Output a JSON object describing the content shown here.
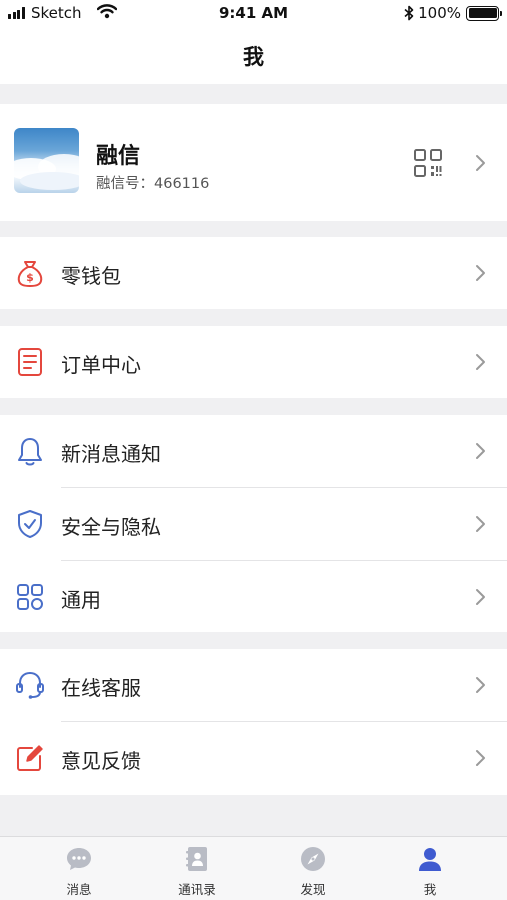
{
  "status_bar": {
    "carrier": "Sketch",
    "time": "9:41 AM",
    "battery_percent": "100%",
    "battery_level": 1.0
  },
  "nav": {
    "title": "我"
  },
  "profile": {
    "name": "融信",
    "id_label": "融信号：466116",
    "icons": {
      "qr": "qr-code-icon",
      "chevron": "chevron-right-icon"
    }
  },
  "menu": [
    {
      "label": "零钱包",
      "icon": "money-bag-icon"
    },
    {
      "label": "订单中心",
      "icon": "order-list-icon"
    },
    {
      "label": "新消息通知",
      "icon": "bell-icon"
    },
    {
      "label": "安全与隐私",
      "icon": "shield-icon"
    },
    {
      "label": "通用",
      "icon": "grid-icon"
    },
    {
      "label": "在线客服",
      "icon": "headset-icon"
    },
    {
      "label": "意见反馈",
      "icon": "edit-feedback-icon"
    }
  ],
  "tabs": [
    {
      "label": "消息",
      "icon": "chat-bubble-icon",
      "active": false
    },
    {
      "label": "通讯录",
      "icon": "contacts-book-icon",
      "active": false
    },
    {
      "label": "发现",
      "icon": "compass-icon",
      "active": false
    },
    {
      "label": "我",
      "icon": "person-icon",
      "active": true
    }
  ],
  "colors": {
    "accent": "#3f5bd0",
    "red": "#e4473d",
    "blue_icon": "#4a6fc9",
    "inactive_tab": "#b9bcc5",
    "background": "#f0f0f2"
  }
}
